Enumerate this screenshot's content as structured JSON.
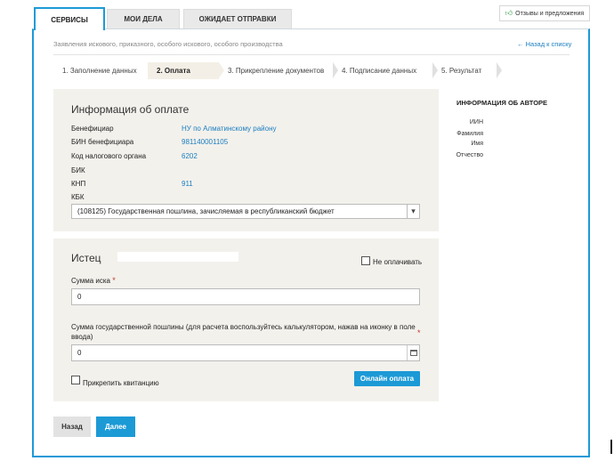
{
  "tabs": [
    {
      "label": "СЕРВИСЫ",
      "active": true
    },
    {
      "label": "МОИ ДЕЛА",
      "active": false
    },
    {
      "label": "ОЖИДАЕТ ОТПРАВКИ",
      "active": false
    }
  ],
  "feedback": {
    "label": "Отзывы и предложения",
    "icon": "thumbs-up-icon"
  },
  "breadcrumb": "Заявления искового, приказного, особого искового, особого производства",
  "back_link": "← Назад к списку",
  "steps": [
    {
      "label": "1. Заполнение данных",
      "active": false
    },
    {
      "label": "2. Оплата",
      "active": true
    },
    {
      "label": "3. Прикрепление документов",
      "active": false
    },
    {
      "label": "4. Подписание данных",
      "active": false
    },
    {
      "label": "5. Результат",
      "active": false
    }
  ],
  "payment": {
    "title": "Информация об оплате",
    "beneficiary_label": "Бенефициар",
    "beneficiary_value": "НУ по Алматинскому району",
    "bin_label": "БИН бенефициара",
    "bin_value": "981140001105",
    "tax_code_label": "Код налогового органа",
    "tax_code_value": "6202",
    "bik_label": "БИК",
    "knp_label": "КНП",
    "knp_value": "911",
    "kbk_label": "КБК",
    "kbk_selected": "(108125) Государственная пошлина, зачисляемая в республиканский бюджет"
  },
  "plaintiff": {
    "title": "Истец",
    "no_pay_label": "Не оплачивать",
    "claim_sum_label": "Сумма иска",
    "claim_sum_value": "0",
    "fee_label": "Сумма государственной пошлины (для расчета воспользуйтесь калькулятором, нажав на иконку в поле ввода)",
    "fee_value": "0",
    "attach_receipt_label": "Прикрепить квитанцию",
    "online_pay_label": "Онлайн оплата"
  },
  "buttons": {
    "back": "Назад",
    "next": "Далее"
  },
  "author": {
    "title": "ИНФОРМАЦИЯ ОБ АВТОРЕ",
    "iin_label": "ИИН",
    "surname_label": "Фамилия",
    "name_label": "Имя",
    "patronymic_label": "Отчество"
  },
  "colors": {
    "accent": "#1c9ad6",
    "link": "#1c7fc0",
    "panel_bg": "#f3f1ec",
    "required": "#c0392b"
  }
}
